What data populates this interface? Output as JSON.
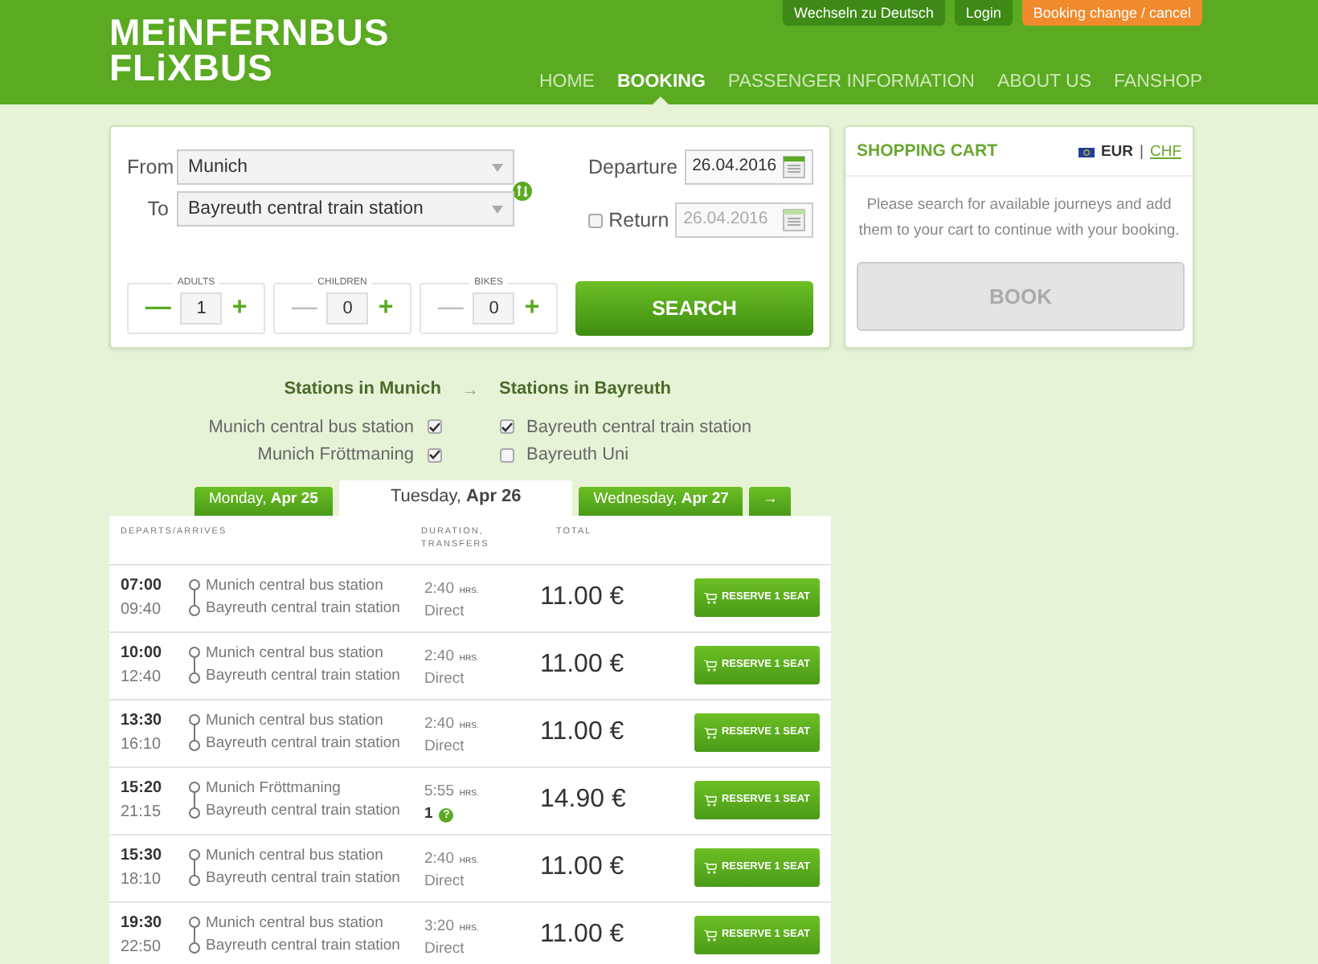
{
  "header": {
    "logo_lines": [
      "MEiNFERNBUS",
      "FLiXBUS"
    ],
    "top_buttons": [
      {
        "label": "Wechseln zu Deutsch",
        "kind": "dark"
      },
      {
        "label": "Login",
        "kind": "dark"
      },
      {
        "label": "Booking change / cancel",
        "kind": "orange"
      }
    ],
    "nav": [
      {
        "label": "HOME",
        "selected": false
      },
      {
        "label": "BOOKING",
        "selected": true
      },
      {
        "label": "PASSENGER INFORMATION",
        "selected": false
      },
      {
        "label": "ABOUT US",
        "selected": false
      },
      {
        "label": "FANSHOP",
        "selected": false
      }
    ]
  },
  "search": {
    "from_label": "From",
    "from": "Munich",
    "to_label": "To",
    "to": "Bayreuth central train station",
    "departure_label": "Departure",
    "departure": "26.04.2016",
    "return_label": "Return",
    "return_checked": false,
    "return": "26.04.2016",
    "counters": [
      {
        "label": "ADULTS",
        "value": "1",
        "minus_enabled": true
      },
      {
        "label": "CHILDREN",
        "value": "0",
        "minus_enabled": false
      },
      {
        "label": "BIKES",
        "value": "0",
        "minus_enabled": false
      }
    ],
    "minus": "—",
    "plus": "+",
    "button": "SEARCH"
  },
  "cart": {
    "title": "SHOPPING CART",
    "currencies": [
      {
        "label": "EUR",
        "selected": true
      },
      {
        "label": "CHF",
        "selected": false
      }
    ],
    "separator": "|",
    "message": "Please search for available journeys and add them to your cart to continue with your booking.",
    "button": {
      "label": "BOOK",
      "disabled": true
    }
  },
  "stations": {
    "from_title": "Stations in Munich",
    "arrow": "→",
    "to_title": "Stations in Bayreuth",
    "from": [
      {
        "label": "Munich central bus station",
        "checked": true
      },
      {
        "label": "Munich Fröttmaning",
        "checked": true
      }
    ],
    "to": [
      {
        "label": "Bayreuth central train station",
        "checked": true
      },
      {
        "label": "Bayreuth Uni",
        "checked": false
      }
    ]
  },
  "day_tabs": [
    {
      "label": "Monday, **Apr 25**",
      "selected": false
    },
    {
      "label": "Tuesday, **Apr 26**",
      "selected": true
    },
    {
      "label": "Wednesday, **Apr 27**",
      "selected": false
    }
  ],
  "next_arrow": "→",
  "table": {
    "columns": [
      "DEPARTS/ARRIVES",
      "DURATION, TRANSFERS",
      "TOTAL"
    ],
    "rows": [
      {
        "depart": "07:00",
        "arrive": "09:40",
        "from": "Munich central bus station",
        "to": "Bayreuth central train station",
        "duration": "2:40",
        "unit": "HRS.",
        "transfers": "Direct",
        "kind": "direct",
        "price": "11.00 €",
        "button": "RESERVE 1 SEAT"
      },
      {
        "depart": "10:00",
        "arrive": "12:40",
        "from": "Munich central bus station",
        "to": "Bayreuth central train station",
        "duration": "2:40",
        "unit": "HRS.",
        "transfers": "Direct",
        "kind": "direct",
        "price": "11.00 €",
        "button": "RESERVE 1 SEAT"
      },
      {
        "depart": "13:30",
        "arrive": "16:10",
        "from": "Munich central bus station",
        "to": "Bayreuth central train station",
        "duration": "2:40",
        "unit": "HRS.",
        "transfers": "Direct",
        "kind": "direct",
        "price": "11.00 €",
        "button": "RESERVE 1 SEAT"
      },
      {
        "depart": "15:20",
        "arrive": "21:15",
        "from": "Munich Fröttmaning",
        "to": "Bayreuth central train station",
        "duration": "5:55",
        "unit": "HRS.",
        "transfers": "1",
        "kind": "transfer",
        "help": "?",
        "price": "14.90 €",
        "button": "RESERVE 1 SEAT"
      },
      {
        "depart": "15:30",
        "arrive": "18:10",
        "from": "Munich central bus station",
        "to": "Bayreuth central train station",
        "duration": "2:40",
        "unit": "HRS.",
        "transfers": "Direct",
        "kind": "direct",
        "price": "11.00 €",
        "button": "RESERVE 1 SEAT"
      },
      {
        "depart": "19:30",
        "arrive": "22:50",
        "from": "Munich central bus station",
        "to": "Bayreuth central train station",
        "duration": "3:20",
        "unit": "HRS.",
        "transfers": "Direct",
        "kind": "direct",
        "price": "11.00 €",
        "button": "RESERVE 1 SEAT"
      }
    ]
  }
}
